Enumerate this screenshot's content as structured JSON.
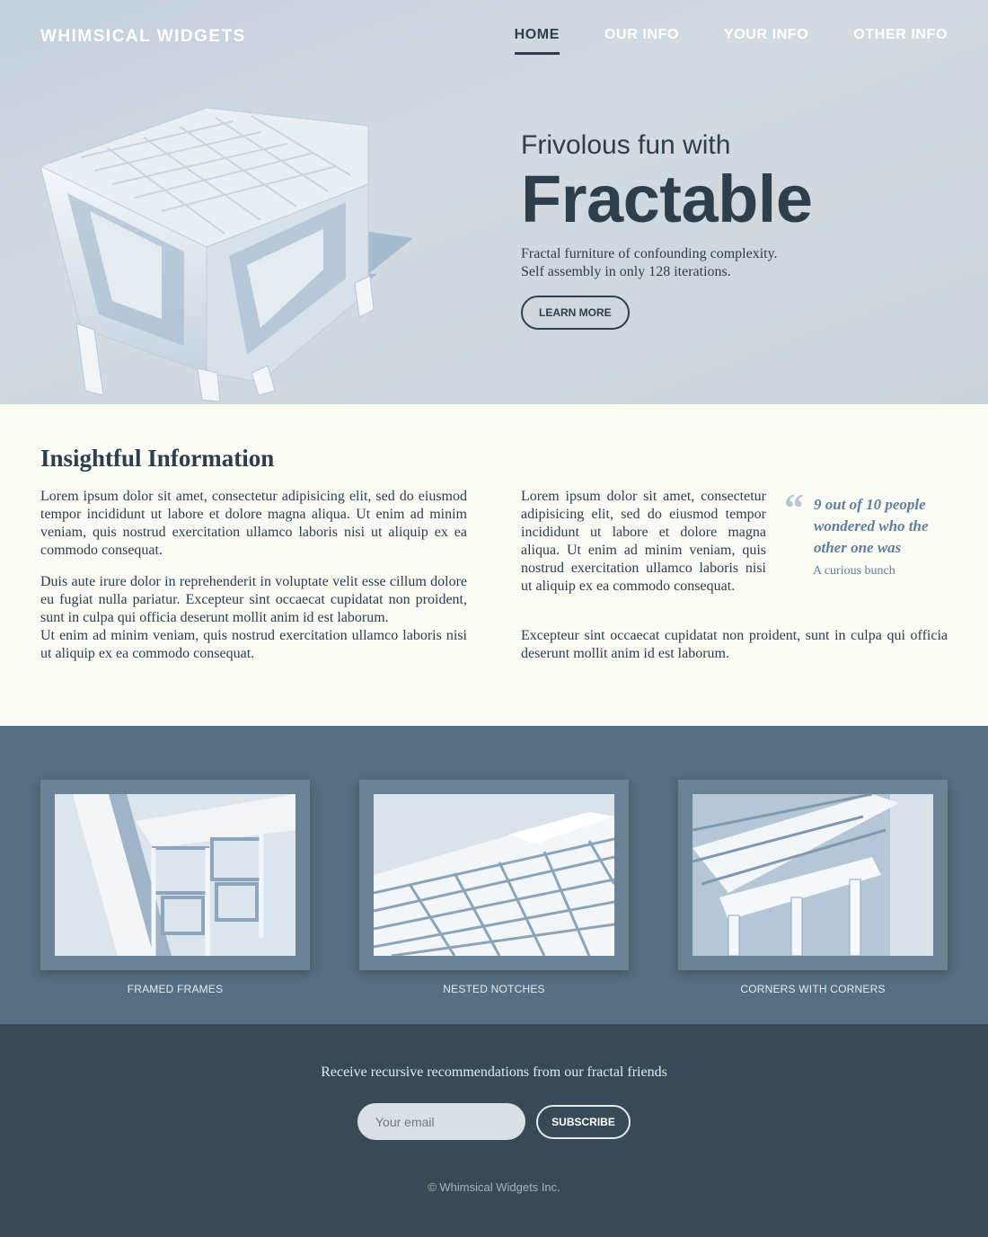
{
  "header": {
    "brand": "WHIMSICAL WIDGETS",
    "nav": [
      {
        "label": "HOME",
        "active": true
      },
      {
        "label": "OUR INFO",
        "active": false
      },
      {
        "label": "YOUR INFO",
        "active": false
      },
      {
        "label": "OTHER INFO",
        "active": false
      }
    ]
  },
  "hero": {
    "subtitle": "Frivolous fun with",
    "title": "Fractable",
    "description_line1": "Fractal furniture of confounding complexity.",
    "description_line2": "Self assembly in only 128 iterations.",
    "button_label": "LEARN MORE",
    "image_icon": "fractal-cube-illustration"
  },
  "info": {
    "heading": "Insightful Information",
    "left_paragraphs": [
      "Lorem ipsum dolor sit amet, consectetur adipisicing elit, sed do eiusmod tempor incididunt ut labore et dolore magna aliqua. Ut enim ad minim veniam, quis nostrud exercitation ullamco laboris nisi ut aliquip ex ea commodo consequat.",
      "Duis aute irure dolor in reprehenderit in voluptate velit esse cillum dolore eu fugiat nulla pariatur. Excepteur sint occaecat cupidatat non proident, sunt in culpa qui officia deserunt mollit anim id est laborum.",
      "Ut enim ad minim veniam, quis nostrud exercitation ullamco laboris nisi ut aliquip ex ea commodo consequat."
    ],
    "right_paragraph": "Lorem ipsum dolor sit amet, consectetur adipisicing elit, sed do eiusmod tempor incididunt ut labore et dolore magna aliqua. Ut enim ad minim veniam, quis nostrud exercitation ullamco laboris nisi ut aliquip ex ea commodo consequat.",
    "right_paragraph_2": "Excepteur sint occaecat cupidatat non proident, sunt in culpa qui officia deserunt mollit anim id est laborum.",
    "quote": {
      "text": "9 out of 10 people wondered who the other one was",
      "source": "A curious bunch",
      "mark": "“"
    }
  },
  "gallery": {
    "items": [
      {
        "label": "FRAMED FRAMES",
        "icon": "fractal-frame-image"
      },
      {
        "label": "NESTED NOTCHES",
        "icon": "fractal-notch-image"
      },
      {
        "label": "CORNERS WITH CORNERS",
        "icon": "fractal-corner-image"
      }
    ]
  },
  "footer": {
    "signup_text": "Receive recursive recommendations from our fractal friends",
    "email_placeholder": "Your email",
    "subscribe_label": "SUBSCRIBE",
    "copyright": "© Whimsical Widgets Inc."
  },
  "colors": {
    "dark": "#2e3e4a",
    "info_bg": "#fbfbf5",
    "gallery_bg": "#566f82",
    "footer_bg": "#374a56",
    "quote": "#5f7f9b"
  }
}
